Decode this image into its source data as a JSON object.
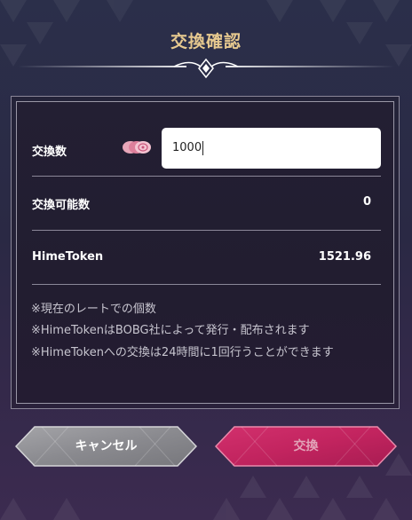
{
  "dialog": {
    "title": "交換確認"
  },
  "rows": {
    "exchange_amount_label": "交換数",
    "exchange_amount_value": "1000",
    "exchangeable_label": "交換可能数",
    "exchangeable_value": "0",
    "token_label": "HimeToken",
    "token_value": "1521.96"
  },
  "notes": [
    "※現在のレートでの個数",
    "※HimeTokenはBOBG社によって発行・配布されます",
    "※HimeTokenへの交換は24時間に1回行うことができます"
  ],
  "buttons": {
    "cancel_label": "キャンセル",
    "exchange_label": "交換"
  },
  "icons": {
    "token": "pink-token-coins-icon"
  },
  "colors": {
    "title": "#e7c98f",
    "exchange_button": "#c2245f",
    "cancel_button": "#8d8d91"
  }
}
